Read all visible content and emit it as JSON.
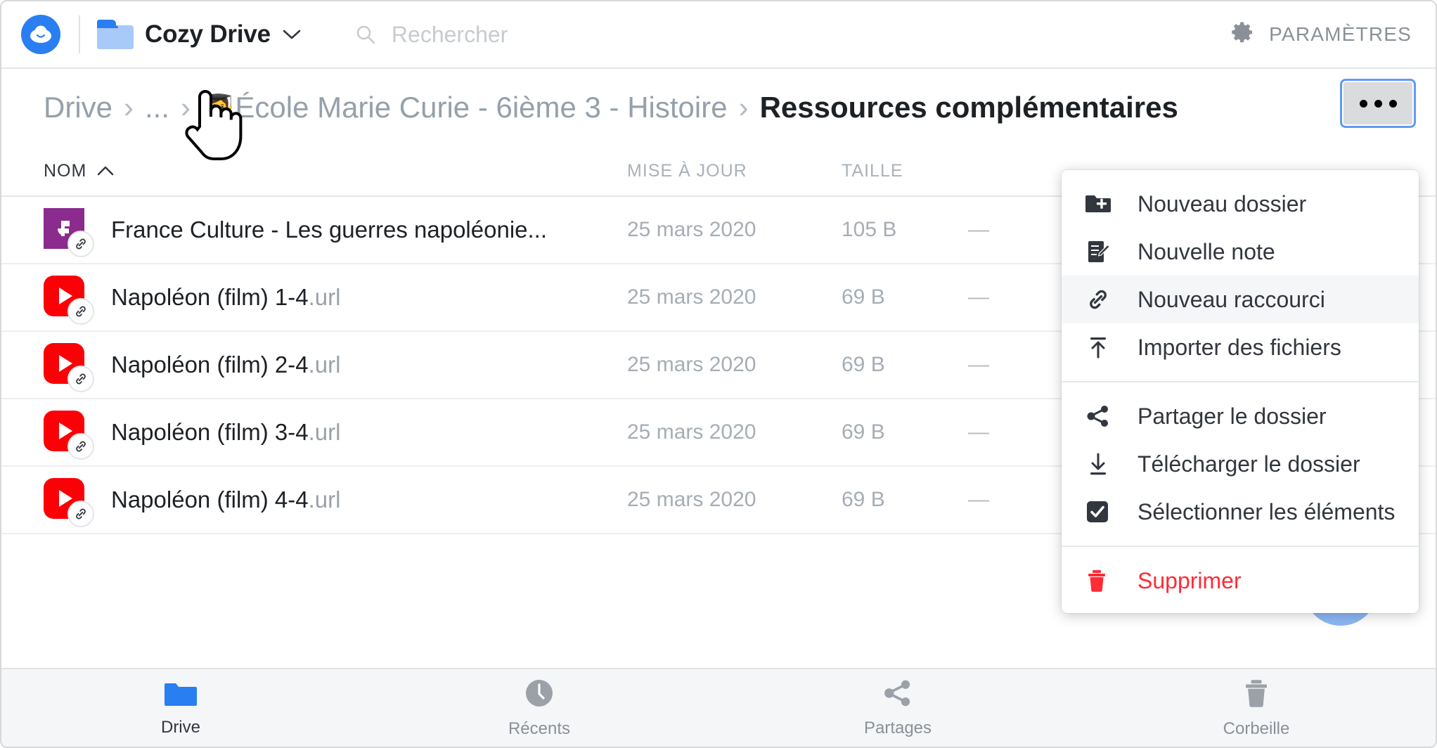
{
  "header": {
    "logo_icon": "cozy-cloud-logo",
    "folder_icon": "folder-icon",
    "app_name": "Cozy Drive",
    "app_chevron": "chevron-down-icon",
    "search": {
      "placeholder": "Rechercher",
      "value": "",
      "icon": "search-icon"
    },
    "settings": {
      "label": "PARAMÈTRES",
      "icon": "gear-icon"
    }
  },
  "breadcrumb": {
    "segments": [
      {
        "label": "Drive",
        "current": false
      },
      {
        "label": "...",
        "current": false
      },
      {
        "label": "École Marie Curie - 6ième 3 - Histoire",
        "emoji": "👩‍🎓",
        "current": false
      },
      {
        "label": "Ressources complémentaires",
        "current": true
      }
    ],
    "separator": "›",
    "more_button": {
      "name": "more-actions-button",
      "icon": "ellipsis-icon"
    }
  },
  "table": {
    "columns": [
      {
        "key": "name",
        "label": "NOM",
        "sort": "asc",
        "sort_icon": "chevron-up-icon"
      },
      {
        "key": "date",
        "label": "MISE À JOUR"
      },
      {
        "key": "size",
        "label": "TAILLE"
      },
      {
        "key": "share",
        "label": ""
      }
    ],
    "rows": [
      {
        "icon": "france-culture-icon",
        "badge": "link-icon",
        "name": "France Culture - Les guerres napoléonie...",
        "ext": "",
        "date": "25 mars 2020",
        "size": "105 B",
        "share": "—"
      },
      {
        "icon": "youtube-icon",
        "badge": "link-icon",
        "name": "Napoléon (film) 1-4",
        "ext": ".url",
        "date": "25 mars 2020",
        "size": "69 B",
        "share": "—"
      },
      {
        "icon": "youtube-icon",
        "badge": "link-icon",
        "name": "Napoléon (film) 2-4",
        "ext": ".url",
        "date": "25 mars 2020",
        "size": "69 B",
        "share": "—"
      },
      {
        "icon": "youtube-icon",
        "badge": "link-icon",
        "name": "Napoléon (film) 3-4",
        "ext": ".url",
        "date": "25 mars 2020",
        "size": "69 B",
        "share": "—"
      },
      {
        "icon": "youtube-icon",
        "badge": "link-icon",
        "name": "Napoléon (film) 4-4",
        "ext": ".url",
        "date": "25 mars 2020",
        "size": "69 B",
        "share": "—"
      }
    ]
  },
  "context_menu": {
    "items": [
      {
        "label": "Nouveau dossier",
        "icon": "folder-plus-icon",
        "hovered": false,
        "danger": false
      },
      {
        "label": "Nouvelle note",
        "icon": "note-edit-icon",
        "hovered": false,
        "danger": false
      },
      {
        "label": "Nouveau raccourci",
        "icon": "link-icon",
        "hovered": true,
        "danger": false
      },
      {
        "label": "Importer des fichiers",
        "icon": "upload-icon",
        "hovered": false,
        "danger": false
      },
      {
        "label": "Partager le dossier",
        "icon": "share-icon",
        "hovered": false,
        "danger": false
      },
      {
        "label": "Télécharger le dossier",
        "icon": "download-icon",
        "hovered": false,
        "danger": false
      },
      {
        "label": "Sélectionner les éléments",
        "icon": "checkbox-icon",
        "hovered": false,
        "danger": false
      },
      {
        "label": "Supprimer",
        "icon": "trash-icon",
        "hovered": false,
        "danger": true
      }
    ]
  },
  "fab": {
    "name": "cozy-assistant-button",
    "icon": "cloud-chat-icon"
  },
  "bottom_nav": {
    "items": [
      {
        "label": "Drive",
        "icon": "folder-icon",
        "active": true
      },
      {
        "label": "Récents",
        "icon": "clock-icon",
        "active": false
      },
      {
        "label": "Partages",
        "icon": "share-icon",
        "active": false
      },
      {
        "label": "Corbeille",
        "icon": "trash-icon",
        "active": false
      }
    ]
  },
  "colors": {
    "accent": "#297ef2",
    "danger": "#ff2b35",
    "youtube": "#fb0006",
    "france_culture": "#8a2b8d",
    "text": "#32363f",
    "muted": "#a6adb5"
  }
}
